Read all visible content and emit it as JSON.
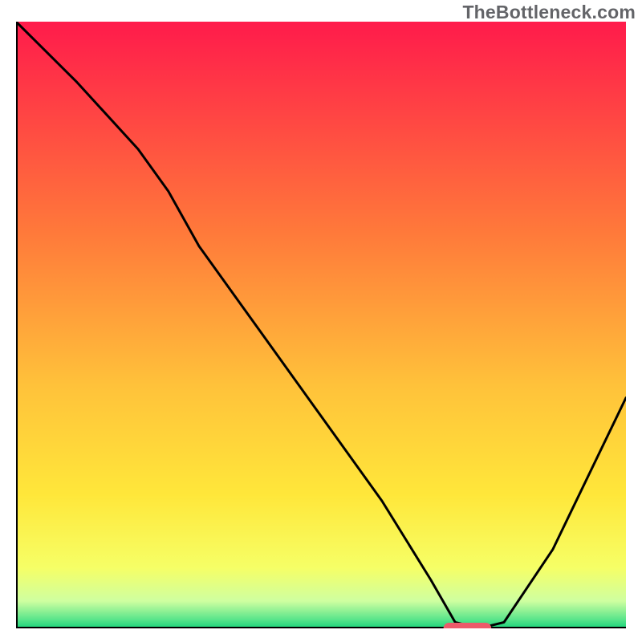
{
  "watermark": "TheBottleneck.com",
  "chart_data": {
    "type": "line",
    "title": "",
    "xlabel": "",
    "ylabel": "",
    "xlim": [
      0,
      100
    ],
    "ylim": [
      0,
      100
    ],
    "grid": false,
    "legend": false,
    "gradient_stops": [
      {
        "offset": 0.0,
        "color": "#ff1b4b"
      },
      {
        "offset": 0.35,
        "color": "#ff7a3a"
      },
      {
        "offset": 0.6,
        "color": "#ffc23a"
      },
      {
        "offset": 0.78,
        "color": "#ffe73a"
      },
      {
        "offset": 0.9,
        "color": "#f6ff66"
      },
      {
        "offset": 0.955,
        "color": "#cfffa0"
      },
      {
        "offset": 0.985,
        "color": "#5be58b"
      },
      {
        "offset": 1.0,
        "color": "#19d47b"
      }
    ],
    "series": [
      {
        "name": "curve",
        "x": [
          0,
          10,
          20,
          25,
          30,
          40,
          50,
          60,
          68,
          72,
          76,
          80,
          88,
          100
        ],
        "y": [
          100,
          90,
          79,
          72,
          63,
          49,
          35,
          21,
          8,
          1,
          0,
          1,
          13,
          38
        ]
      }
    ],
    "bottom_marker": {
      "x_start": 71,
      "x_end": 77,
      "y": 0
    }
  }
}
